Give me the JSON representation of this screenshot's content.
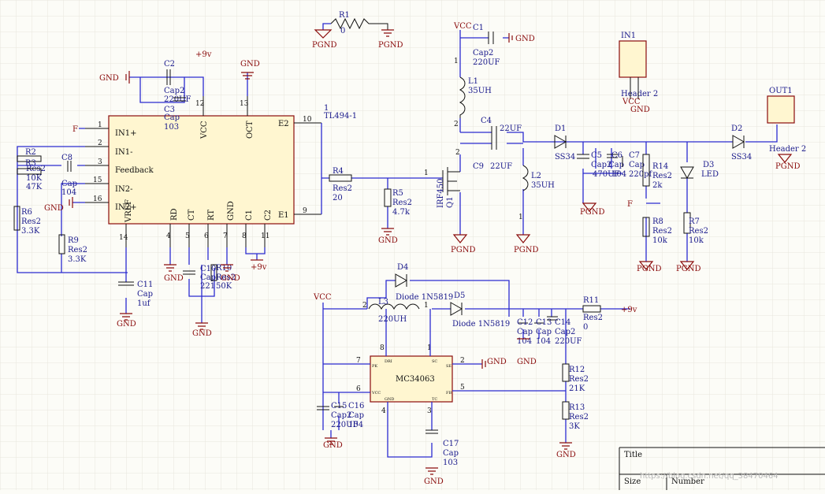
{
  "power": {
    "gnd": "GND",
    "pgnd": "PGND",
    "vcc": "VCC",
    "p9v": "+9v",
    "fb": "F"
  },
  "u1": {
    "name": "TL494-1",
    "pin1": "1",
    "pins": {
      "in1p": "IN1+",
      "in1n": "IN1-",
      "fb": "Feedback",
      "in2n": "IN2-",
      "in2p": "IN2+",
      "vref": "VREF",
      "rd": "RD",
      "ct": "CT",
      "rt": "RT",
      "gnd": "GND",
      "c1": "C1",
      "c2": "C2",
      "e1": "E1",
      "e2": "E2",
      "vcc": "VCC",
      "oct": "OCT"
    },
    "nums": {
      "n1": "1",
      "n2": "2",
      "n3": "3",
      "n15": "15",
      "n16": "16",
      "n14": "14",
      "n4": "4",
      "n5": "5",
      "n6": "6",
      "n7": "7",
      "n8": "8",
      "n11": "11",
      "n9": "9",
      "n10": "10",
      "n12": "12",
      "n13": "13"
    }
  },
  "u2": {
    "name": "MC34063",
    "pins": {
      "dri": "DRI",
      "sc": "SC",
      "se": "SE",
      "pk": "PK",
      "fb": "FB",
      "vcc": "VCC",
      "gnd": "GND",
      "tc": "TC"
    },
    "nums": {
      "n8": "8",
      "n1": "1",
      "n7": "7",
      "n6": "6",
      "n2": "2",
      "n5": "5",
      "n4": "4",
      "n3": "3"
    }
  },
  "parts": {
    "R1": {
      "ref": "R1",
      "val": "0"
    },
    "R2": {
      "ref": "R2",
      "type": "Res2",
      "val": "47K"
    },
    "R3": {
      "ref": "R3",
      "type": "Res2",
      "val": "10K"
    },
    "R4": {
      "ref": "R4",
      "type": "Res2",
      "val": "20"
    },
    "R5": {
      "ref": "R5",
      "type": "Res2",
      "val": "4.7k"
    },
    "R6": {
      "ref": "R6",
      "type": "Res2",
      "val": "3.3K"
    },
    "R7": {
      "ref": "R7",
      "type": "Res2",
      "val": "10k"
    },
    "R8": {
      "ref": "R8",
      "type": "Res2",
      "val": "10k"
    },
    "R9": {
      "ref": "R9",
      "type": "Res2",
      "val": "3.3K"
    },
    "R10": {
      "ref": "R10",
      "type": "Res2",
      "val": "50K"
    },
    "R11": {
      "ref": "R11",
      "type": "Res2",
      "val": "0"
    },
    "R12": {
      "ref": "R12",
      "type": "Res2",
      "val": "21K"
    },
    "R13": {
      "ref": "R13",
      "type": "Res2",
      "val": "3K"
    },
    "R14": {
      "ref": "R14",
      "type": "Res2",
      "val": "2k"
    },
    "C1": {
      "ref": "C1",
      "type": "Cap2",
      "val": "220UF"
    },
    "C2": {
      "ref": "C2",
      "type": "Cap2",
      "val": "220UF"
    },
    "C3": {
      "ref": "C3",
      "type": "Cap",
      "val": "103"
    },
    "C4": {
      "ref": "C4",
      "val": "22UF"
    },
    "C5": {
      "ref": "C5",
      "type": "Cap2",
      "val": "470UF"
    },
    "C6": {
      "ref": "C6",
      "type": "Cap",
      "val": "104"
    },
    "C7": {
      "ref": "C7",
      "type": "Cap",
      "val": "220pf"
    },
    "C8": {
      "ref": "C8",
      "type": "Cap",
      "val": "104"
    },
    "C9": {
      "ref": "C9",
      "val": "22UF"
    },
    "C10": {
      "ref": "C10",
      "type": "Cap",
      "val": "221"
    },
    "C11": {
      "ref": "C11",
      "type": "Cap",
      "val": "1uf"
    },
    "C12": {
      "ref": "C12",
      "type": "Cap",
      "val": "104"
    },
    "C13": {
      "ref": "C13",
      "type": "Cap",
      "val": "104"
    },
    "C14": {
      "ref": "C14",
      "type": "Cap2",
      "val": "220UF"
    },
    "C15": {
      "ref": "C15",
      "type": "Cap2",
      "val": "220UF"
    },
    "C16": {
      "ref": "C16",
      "type": "Cap",
      "val": "104"
    },
    "C17": {
      "ref": "C17",
      "type": "Cap",
      "val": "103"
    },
    "L1": {
      "ref": "L1",
      "val": "35UH"
    },
    "L2": {
      "ref": "L2",
      "val": "35UH"
    },
    "L3": {
      "ref": "L3",
      "val": "220UH"
    },
    "D1": {
      "ref": "D1",
      "val": "SS34"
    },
    "D2": {
      "ref": "D2",
      "val": "SS34"
    },
    "D3": {
      "ref": "D3",
      "val": "LED"
    },
    "D4": {
      "ref": "D4",
      "val": "Diode 1N5819"
    },
    "D5": {
      "ref": "D5",
      "val": "Diode 1N5819"
    },
    "Q1": {
      "ref": "Q1",
      "val": "IRF450"
    },
    "IN1": {
      "ref": "IN1",
      "val": "Header 2"
    },
    "OUT1": {
      "ref": "OUT1",
      "val": "Header 2"
    }
  },
  "pinnums": {
    "one": "1",
    "two": "2"
  },
  "titleblock": {
    "title": "Title",
    "size": "Size",
    "number": "Number"
  },
  "watermark": "https://blog.csdn.net/qq_38470464",
  "colors": {
    "wire": "#2b2bd0",
    "body": "#8a0c0c",
    "fill": "#fff6d0",
    "text": "#1a1a8c"
  }
}
